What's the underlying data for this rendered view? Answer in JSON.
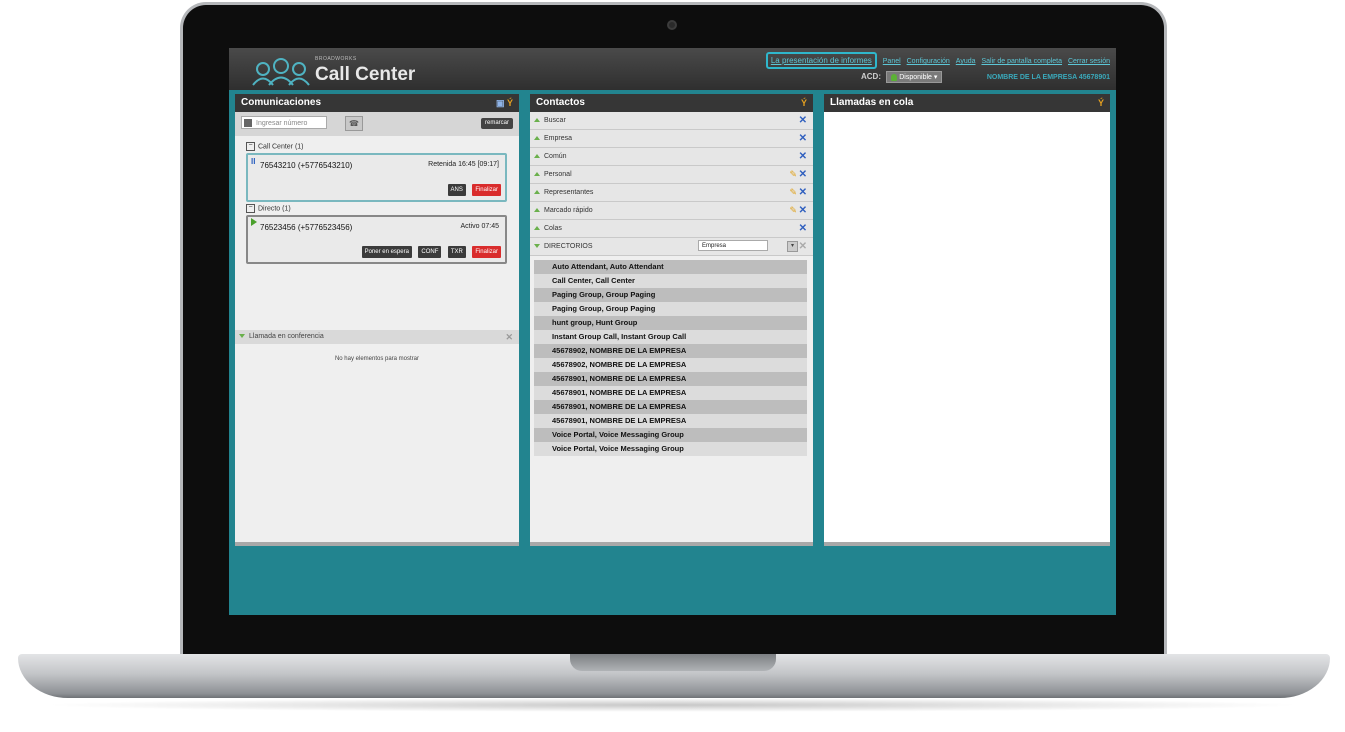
{
  "app": {
    "brand_small": "BROADWORKS",
    "brand": "Call Center"
  },
  "top_links": {
    "reports": "La presentación de informes",
    "panel": "Panel",
    "config": "Configuración",
    "help": "Ayuda",
    "fullscreen": "Salir de pantalla completa",
    "logout": "Cerrar sesión"
  },
  "acd": {
    "label": "ACD:",
    "status": "Disponible",
    "status_color": "#5bb135"
  },
  "company": "NOMBRE DE LA EMPRESA 45678901",
  "communications": {
    "title": "Comunicaciones",
    "dial_placeholder": "Ingresar número",
    "redial": "remarcar",
    "groups": [
      {
        "label": "Call Center (1)",
        "call": {
          "number": "76543210 (+5776543210)",
          "status": "Retenida 16:45 [09:17]",
          "buttons": [
            "ANS",
            "Finalizar"
          ]
        }
      },
      {
        "label": "Directo (1)",
        "call": {
          "number": "76523456 (+5776523456)",
          "status": "Activo 07:45",
          "buttons": [
            "Poner en espera",
            "CONF",
            "TXR",
            "Finalizar"
          ]
        }
      }
    ],
    "conference_label": "Llamada en conferencia",
    "empty_text": "No hay elementos para mostrar"
  },
  "contacts": {
    "title": "Contactos",
    "sections": [
      {
        "label": "Buscar",
        "editable": false
      },
      {
        "label": "Empresa",
        "editable": false
      },
      {
        "label": "Común",
        "editable": false
      },
      {
        "label": "Personal",
        "editable": true
      },
      {
        "label": "Representantes",
        "editable": true
      },
      {
        "label": "Marcado rápido",
        "editable": true
      },
      {
        "label": "Colas",
        "editable": false
      }
    ],
    "directories_label": "DIRECTORIOS",
    "directories_select": "Empresa",
    "directory_items": [
      "Auto Attendant, Auto Attendant",
      "Call Center, Call Center",
      "Paging Group, Group Paging",
      "Paging Group, Group Paging",
      "hunt group, Hunt Group",
      "Instant Group Call, Instant Group Call",
      "45678902, NOMBRE DE LA EMPRESA",
      "45678902, NOMBRE DE LA EMPRESA",
      "45678901, NOMBRE DE LA EMPRESA",
      "45678901, NOMBRE DE LA EMPRESA",
      "45678901, NOMBRE DE LA EMPRESA",
      "45678901, NOMBRE DE LA EMPRESA",
      "Voice Portal, Voice Messaging Group",
      "Voice Portal, Voice Messaging Group"
    ]
  },
  "queue": {
    "title": "Llamadas en cola"
  },
  "colors": {
    "accent": "#22848f",
    "link": "#5cc6d6",
    "end_call": "#d92c2c"
  }
}
